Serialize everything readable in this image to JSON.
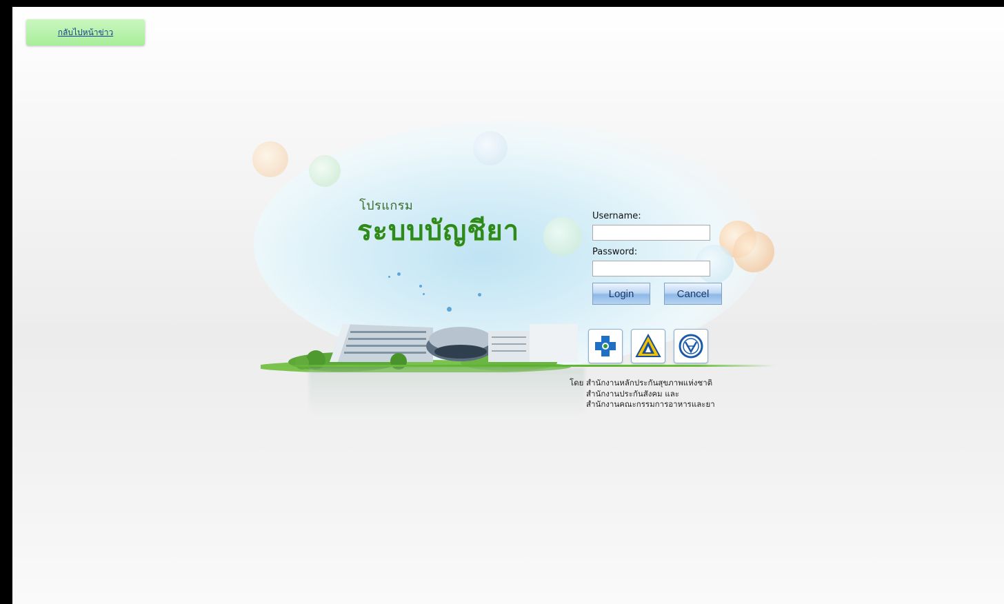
{
  "back_link": {
    "label": "กลับไปหน้าข่าว"
  },
  "branding": {
    "title_small": "โปรแกรม",
    "title_big": "ระบบบัญชียา"
  },
  "login": {
    "username_label": "Username:",
    "password_label": "Password:",
    "username_value": "",
    "password_value": "",
    "login_button": "Login",
    "cancel_button": "Cancel"
  },
  "logos": [
    {
      "icon": "nhso-cross-icon"
    },
    {
      "icon": "sso-triangle-icon"
    },
    {
      "icon": "fda-circle-icon"
    }
  ],
  "byline": {
    "prefix": "โดย",
    "line1": "สำนักงานหลักประกันสุขภาพแห่งชาติ",
    "line2": "สำนักงานประกันสังคม  และ",
    "line3": "สำนักงานคณะกรรมการอาหารและยา"
  },
  "colors": {
    "title_green": "#2f8a1e",
    "back_button_bg": "#b6f0a8",
    "button_blue": "#8db8e6"
  }
}
